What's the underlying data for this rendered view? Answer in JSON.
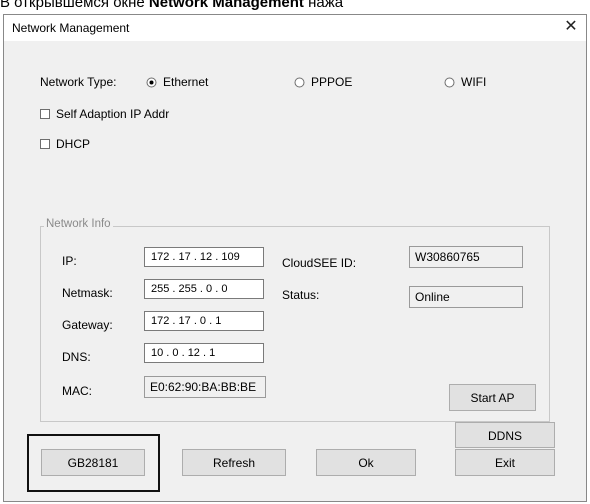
{
  "caption": {
    "prefix": "В открывшемся окне ",
    "bold": "Network Management",
    "suffix": " нажа"
  },
  "window": {
    "title": "Network Management",
    "close_glyph": "✕"
  },
  "network_type": {
    "label": "Network Type:",
    "options": [
      "Ethernet",
      "PPPOE",
      "WIFI"
    ],
    "selected": "Ethernet"
  },
  "checkboxes": {
    "self_adaption": "Self Adaption IP Addr",
    "dhcp": "DHCP"
  },
  "network_info": {
    "legend": "Network Info",
    "ip": {
      "label": "IP:",
      "value": "172 . 17 . 12 . 109"
    },
    "netmask": {
      "label": "Netmask:",
      "value": "255 . 255 . 0 . 0"
    },
    "gateway": {
      "label": "Gateway:",
      "value": "172 . 17 . 0 . 1"
    },
    "dns": {
      "label": "DNS:",
      "value": "10 . 0 . 12 . 1"
    },
    "mac": {
      "label": "MAC:",
      "value": "E0:62:90:BA:BB:BE"
    },
    "cloudsee": {
      "label": "CloudSEE ID:",
      "value": "W30860765"
    },
    "status": {
      "label": "Status:",
      "value": "Online"
    }
  },
  "buttons": {
    "start_ap": "Start AP",
    "ddns": "DDNS",
    "gb28181": "GB28181",
    "refresh": "Refresh",
    "ok": "Ok",
    "exit": "Exit"
  },
  "colors": {
    "highlight_border": "#111111",
    "dialog_bg": "#f0f0f0"
  }
}
